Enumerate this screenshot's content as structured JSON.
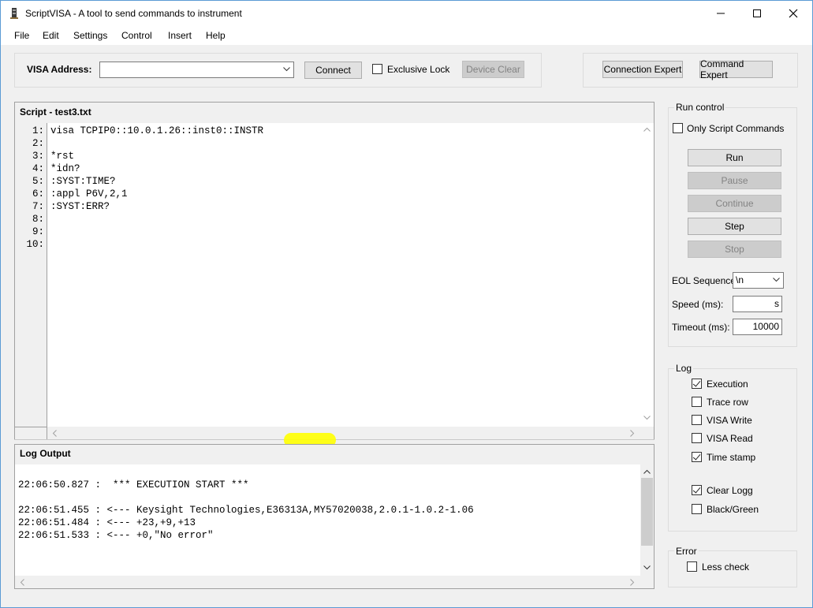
{
  "window": {
    "title": "ScriptVISA - A tool to send commands to instrument"
  },
  "menu": [
    "File",
    "Edit",
    "Settings",
    "Control",
    "Insert",
    "Help"
  ],
  "toolbar": {
    "visa_address_label": "VISA Address:",
    "visa_address_value": "",
    "connect_label": "Connect",
    "exclusive_lock_label": "Exclusive Lock",
    "exclusive_lock_checked": false,
    "device_clear_label": "Device Clear",
    "connection_expert_label": "Connection Expert",
    "command_expert_label": "Command Expert"
  },
  "script": {
    "header": "Script - test3.txt",
    "line_numbers": [
      "1:",
      "2:",
      "3:",
      "4:",
      "5:",
      "6:",
      "7:",
      "8:",
      "9:",
      "10:"
    ],
    "lines": [
      "visa TCPIP0::10.0.1.26::inst0::INSTR",
      "",
      "*rst",
      "*idn?",
      ":SYST:TIME?",
      ":appl P6V,2,1",
      ":SYST:ERR?",
      "",
      "",
      ""
    ]
  },
  "log_output": {
    "header": "Log Output",
    "lines": [
      "",
      "22:06:50.827 :  *** EXECUTION START ***",
      "",
      "22:06:51.455 : <--- Keysight Technologies,E36313A,MY57020038,2.0.1-1.0.2-1.06",
      "22:06:51.484 : <--- +23,+9,+13",
      "22:06:51.533 : <--- +0,\"No error\""
    ]
  },
  "run_control": {
    "title": "Run control",
    "only_script_label": "Only Script Commands",
    "only_script_checked": false,
    "run_label": "Run",
    "pause_label": "Pause",
    "continue_label": "Continue",
    "step_label": "Step",
    "stop_label": "Stop",
    "eol_label": "EOL Sequence:",
    "eol_value": "\\n",
    "speed_label": "Speed (ms):",
    "speed_value": "s",
    "timeout_label": "Timeout (ms):",
    "timeout_value": "10000"
  },
  "log_options": {
    "title": "Log",
    "execution_label": "Execution",
    "execution_checked": true,
    "trace_row_label": "Trace row",
    "trace_row_checked": false,
    "visa_write_label": "VISA Write",
    "visa_write_checked": false,
    "visa_read_label": "VISA Read",
    "visa_read_checked": false,
    "time_stamp_label": "Time stamp",
    "time_stamp_checked": true,
    "clear_logg_label": "Clear Logg",
    "clear_logg_checked": true,
    "black_green_label": "Black/Green",
    "black_green_checked": false
  },
  "error_options": {
    "title": "Error",
    "less_check_label": "Less check",
    "less_check_checked": false
  },
  "colors": {
    "window_bg": "#f0f0f0",
    "highlight": "#ffff00",
    "disabled_button": "#cccccc"
  }
}
